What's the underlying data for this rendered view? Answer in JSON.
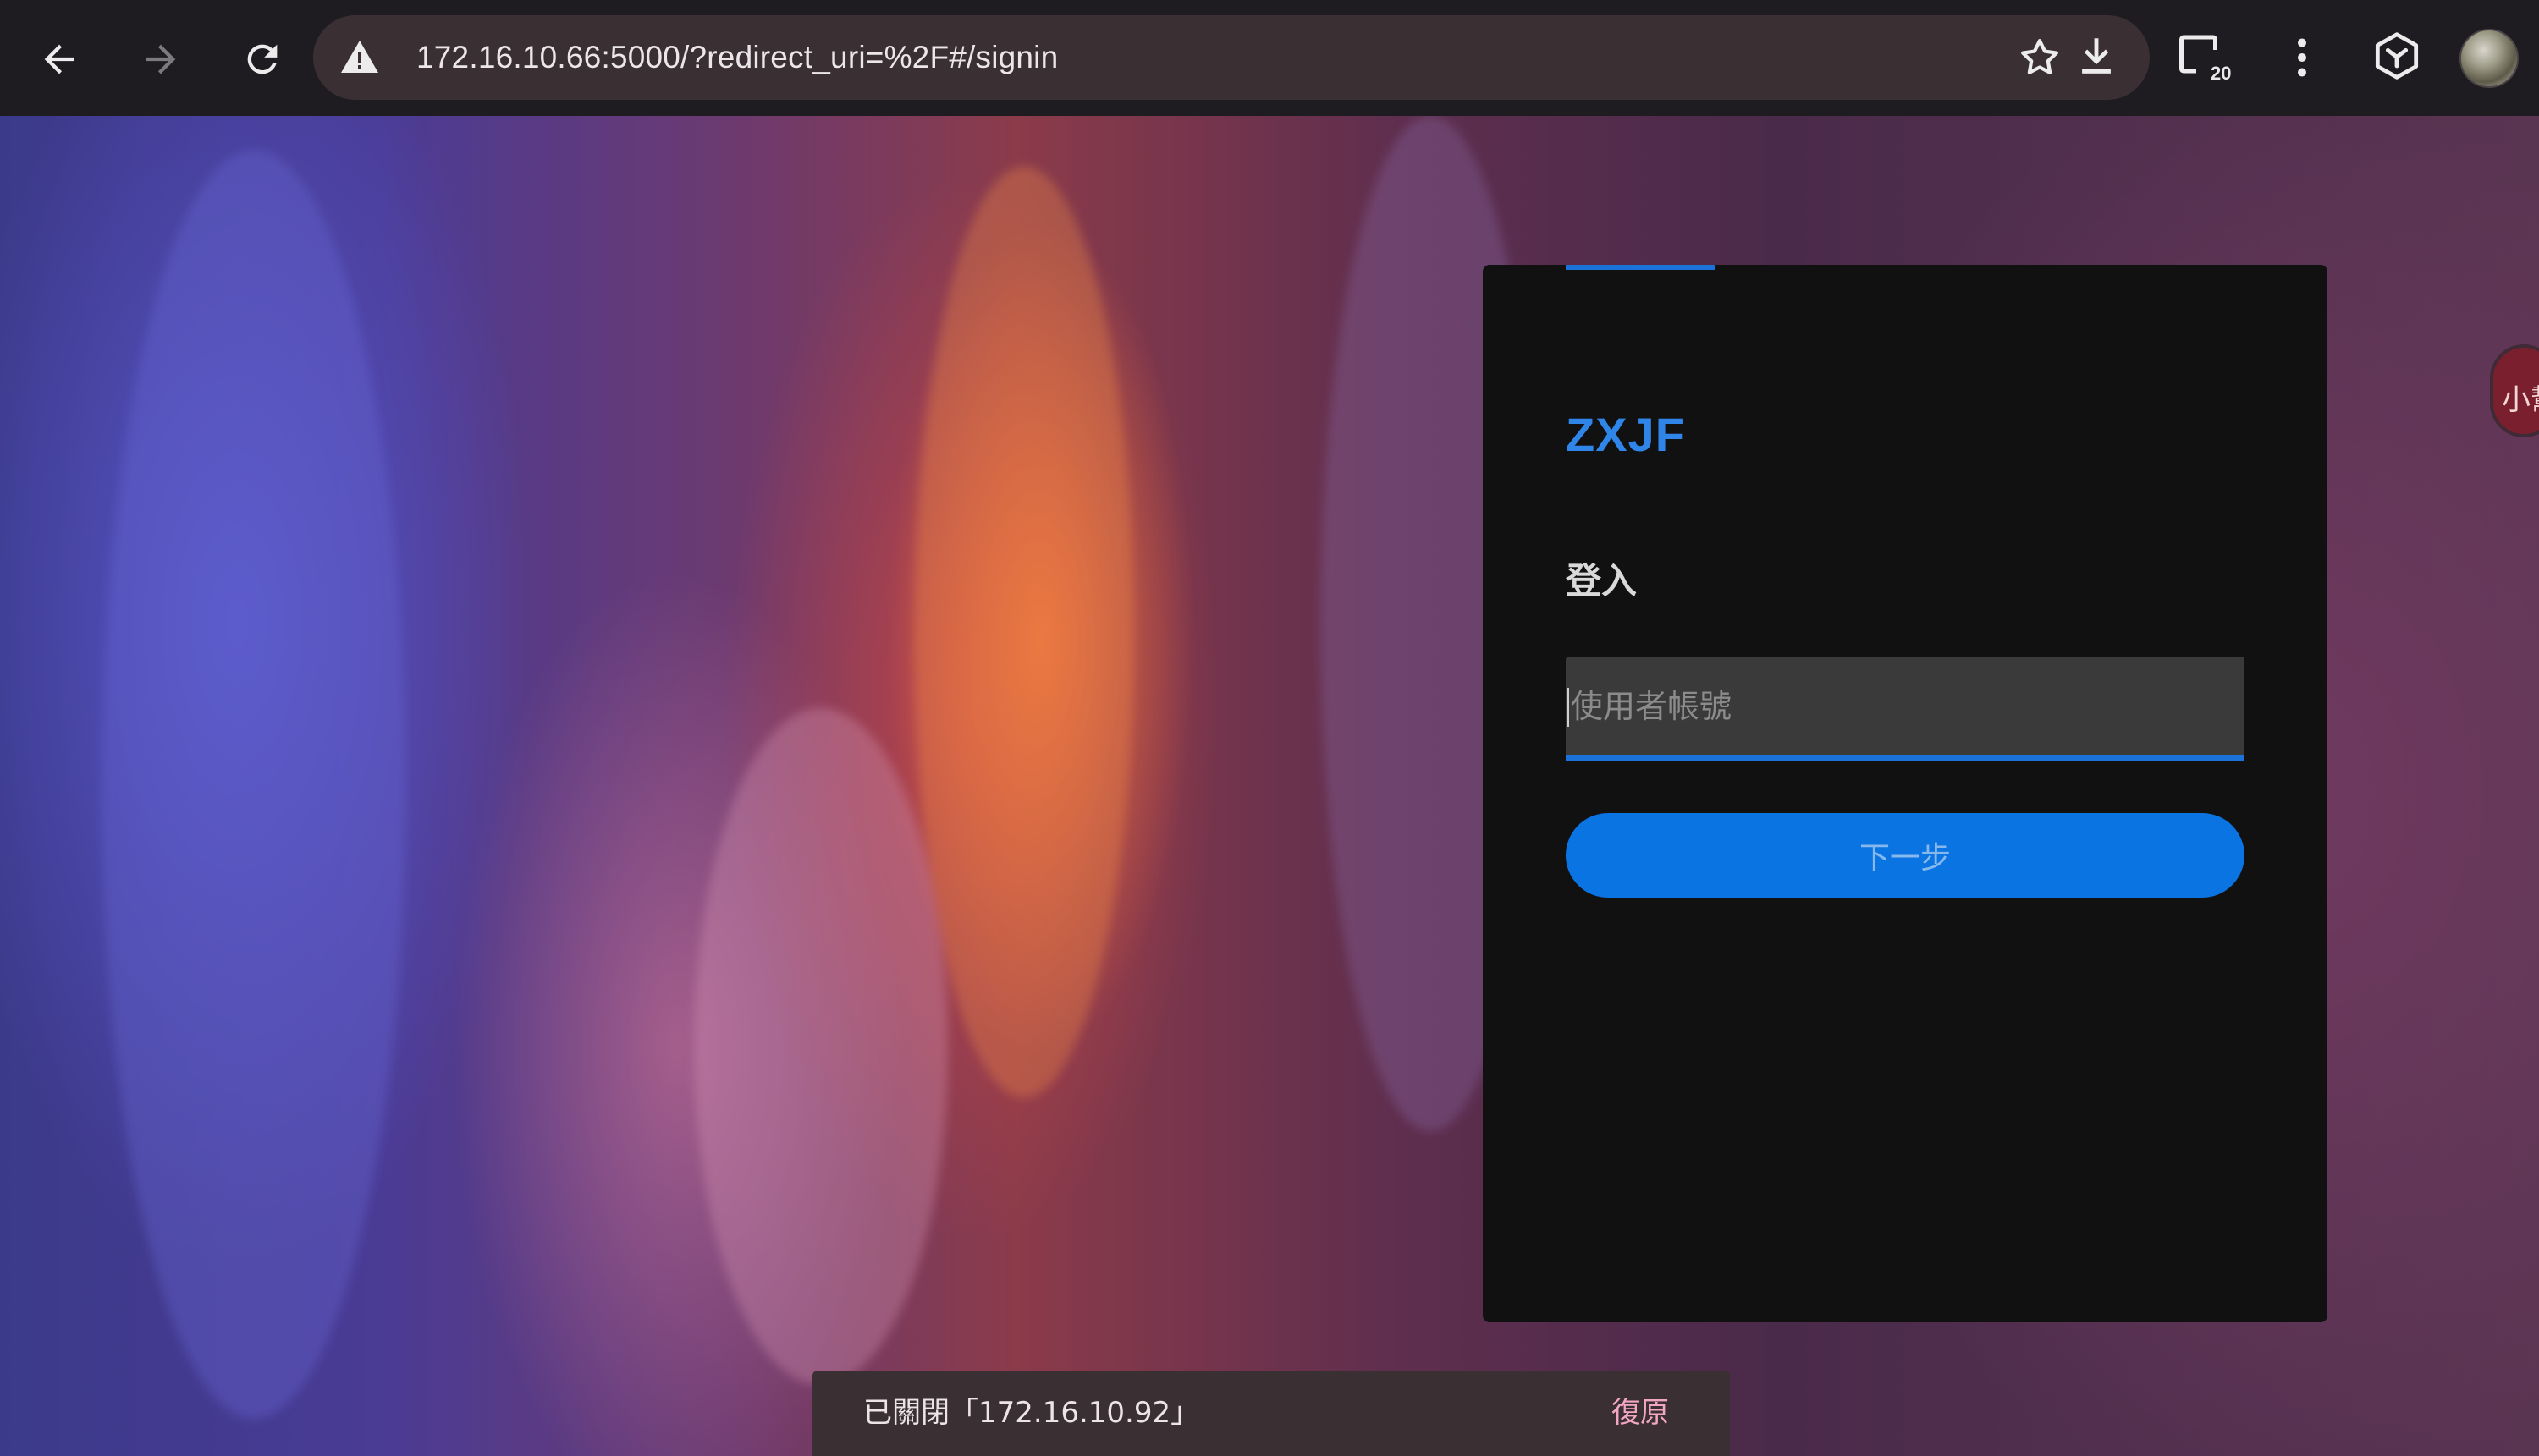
{
  "browser": {
    "back_icon": "arrow-left-icon",
    "forward_icon": "arrow-right-icon",
    "reload_icon": "reload-icon",
    "security_icon": "warning-triangle-icon",
    "url": "172.16.10.66:5000/?redirect_uri=%2F#/signin",
    "bookmark_icon": "star-icon",
    "download_icon": "download-icon",
    "tab_count": "20",
    "menu_icon": "more-vert-icon",
    "extension_icon": "cube-extension-icon",
    "profile_icon": "avatar-icon"
  },
  "side_bubble": {
    "label": "小幫"
  },
  "login": {
    "brand": "ZXJF",
    "title": "登入",
    "username_placeholder": "使用者帳號",
    "username_value": "",
    "next_label": "下一步",
    "accent_color": "#1b72d8"
  },
  "snackbar": {
    "message": "已關閉「172.16.10.92」",
    "action": "復原"
  }
}
